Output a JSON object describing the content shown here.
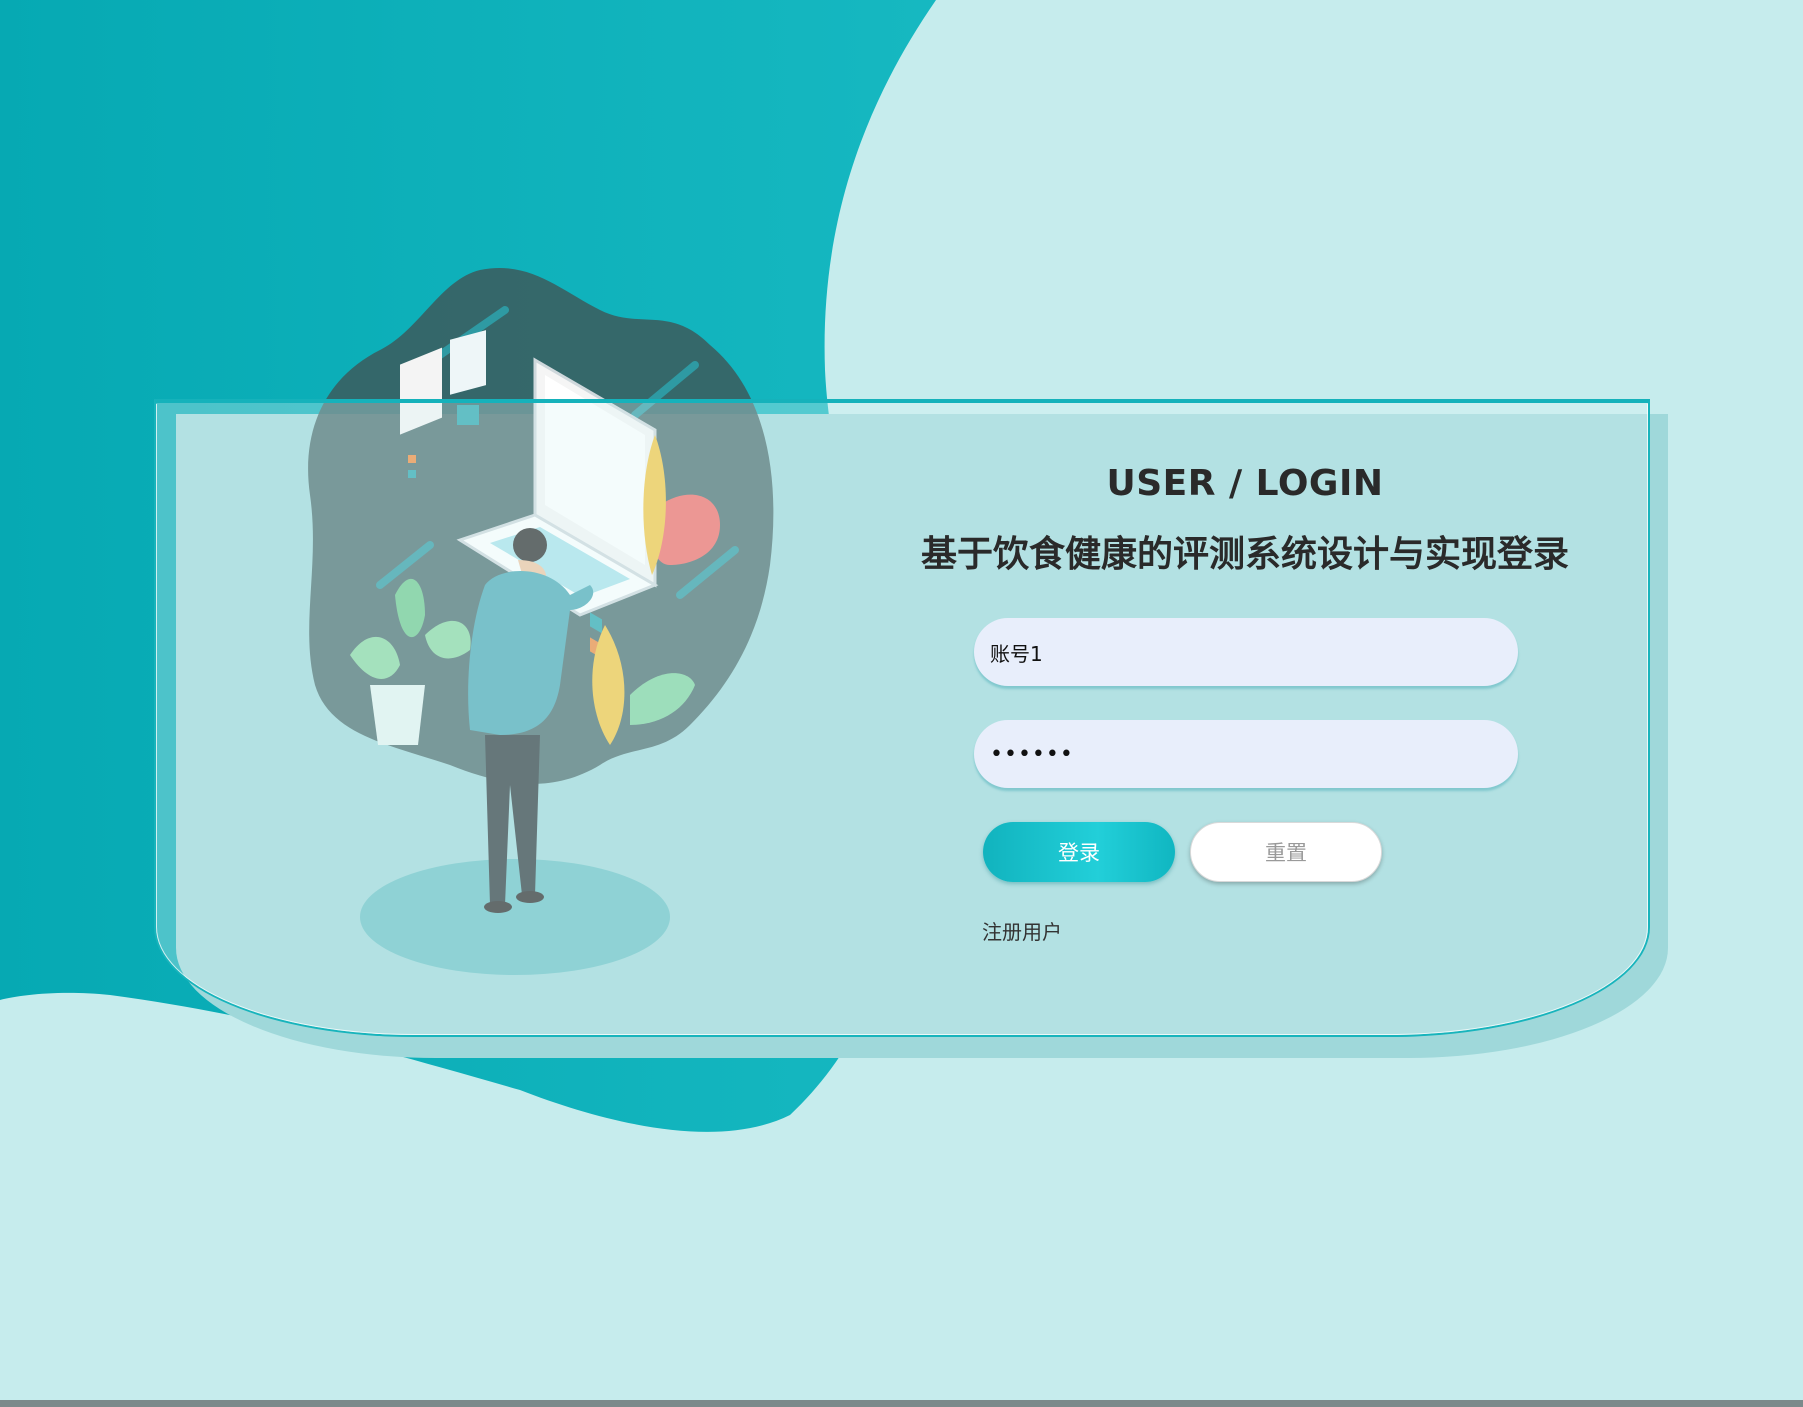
{
  "page": {
    "title_en": "USER / LOGIN",
    "title_cn": "基于饮食健康的评测系统设计与实现登录"
  },
  "form": {
    "username_value": "账号1",
    "password_value": "123456",
    "login_label": "登录",
    "reset_label": "重置",
    "register_label": "注册用户"
  },
  "colors": {
    "teal_primary": "#11b0bb",
    "background_light": "#c3eaed",
    "input_bg": "#e8eefb",
    "text_dark": "#2a2a2a"
  },
  "icons": {
    "illustration": "person-at-laptop-illustration"
  }
}
